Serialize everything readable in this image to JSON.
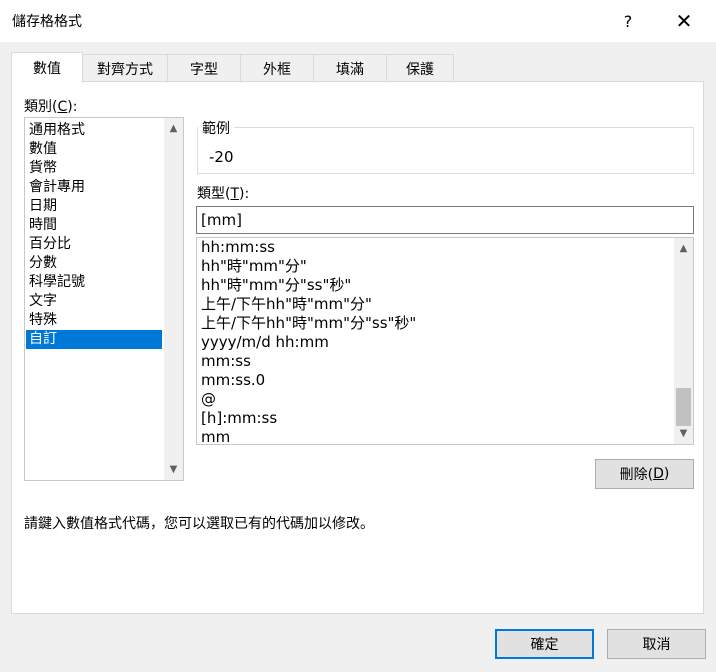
{
  "window": {
    "title": "儲存格格式",
    "help": "?",
    "close": "✕"
  },
  "tabs": [
    {
      "label": "數值",
      "active": true
    },
    {
      "label": "對齊方式"
    },
    {
      "label": "字型"
    },
    {
      "label": "外框"
    },
    {
      "label": "填滿"
    },
    {
      "label": "保護"
    }
  ],
  "category": {
    "label_pre": "類別(",
    "label_key": "C",
    "label_post": "):",
    "items": [
      "通用格式",
      "數值",
      "貨幣",
      "會計專用",
      "日期",
      "時間",
      "百分比",
      "分數",
      "科學記號",
      "文字",
      "特殊",
      "自訂"
    ],
    "selected": "自訂"
  },
  "sample": {
    "legend": "範例",
    "value": "-20"
  },
  "type": {
    "label_pre": "類型(",
    "label_key": "T",
    "label_post": "):",
    "value": "[mm]",
    "formats": [
      "hh:mm:ss",
      "hh\"時\"mm\"分\"",
      "hh\"時\"mm\"分\"ss\"秒\"",
      "上午/下午hh\"時\"mm\"分\"",
      "上午/下午hh\"時\"mm\"分\"ss\"秒\"",
      "yyyy/m/d hh:mm",
      "mm:ss",
      "mm:ss.0",
      "@",
      "[h]:mm:ss",
      "mm"
    ]
  },
  "delete_button": {
    "pre": "刪除(",
    "key": "D",
    "post": ")"
  },
  "hint": "請鍵入數值格式代碼，您可以選取已有的代碼加以修改。",
  "ok_label": "確定",
  "cancel_label": "取消",
  "colors": {
    "selection": "#0078d7",
    "panel": "#ffffff",
    "dialog": "#f0f0f0"
  }
}
